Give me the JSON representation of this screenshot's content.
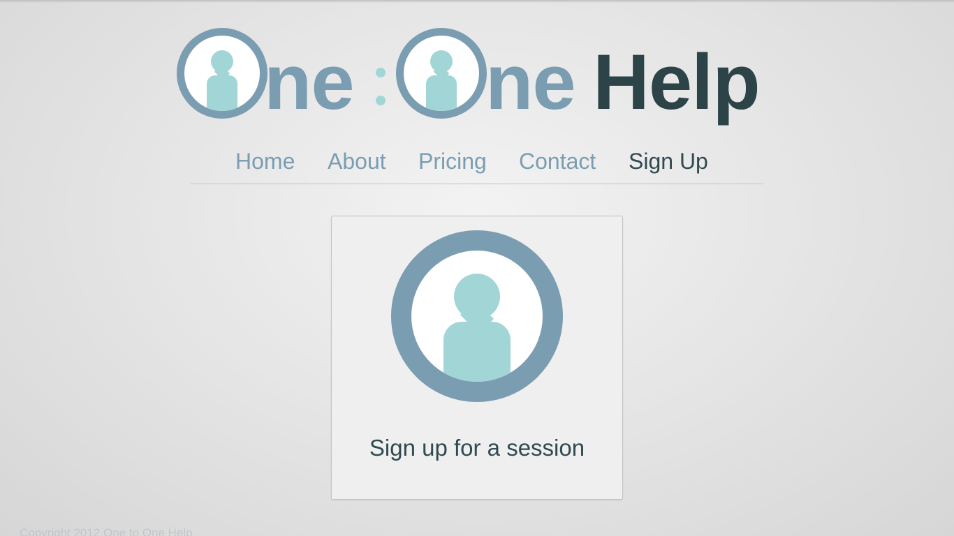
{
  "logo": {
    "one_1": "ne",
    "one_2": "ne",
    "help": "Help",
    "colors": {
      "ring": "#7a9db1",
      "figure": "#a2d6d6",
      "help": "#2c4347"
    }
  },
  "nav": {
    "items": [
      {
        "label": "Home"
      },
      {
        "label": "About"
      },
      {
        "label": "Pricing"
      },
      {
        "label": "Contact"
      },
      {
        "label": "Sign Up",
        "active": true
      }
    ]
  },
  "card": {
    "icon": "person-in-circle-icon",
    "label": "Sign up for a session"
  },
  "footer": {
    "copyright": "Copyright 2012 One to One Help"
  }
}
